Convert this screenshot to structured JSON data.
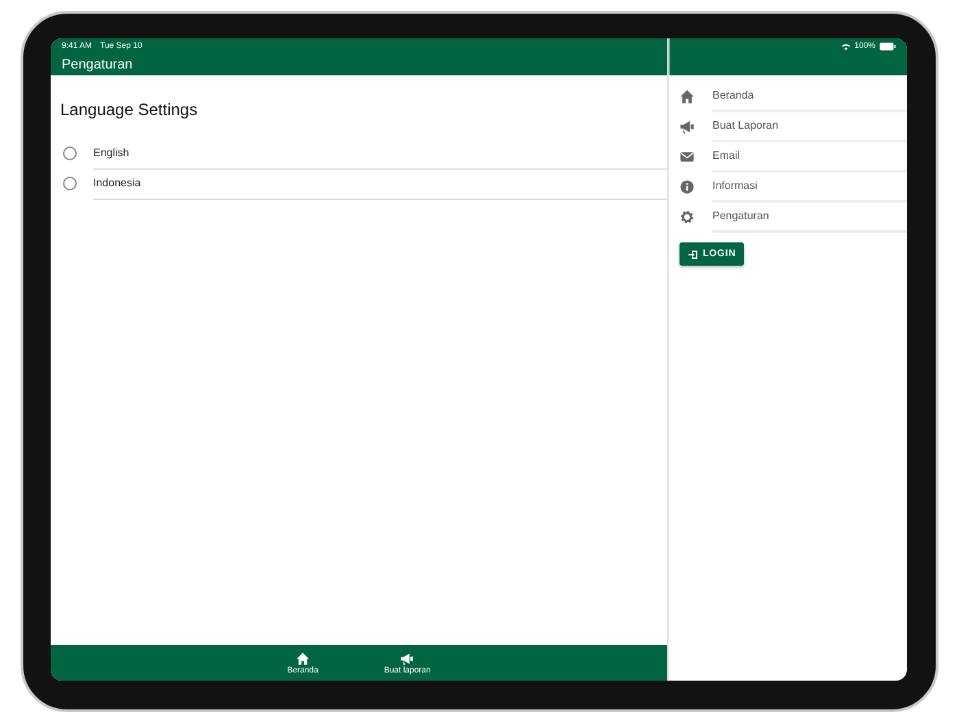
{
  "status_bar": {
    "time": "9:41 AM",
    "date": "Tue Sep 10",
    "battery": "100%"
  },
  "header": {
    "title": "Pengaturan"
  },
  "page": {
    "heading": "Language Settings",
    "options": [
      {
        "label": "English",
        "selected": false
      },
      {
        "label": "Indonesia",
        "selected": false
      }
    ]
  },
  "bottom_tabs": [
    {
      "label": "Beranda",
      "kind": "home"
    },
    {
      "label": "Buat laporan",
      "kind": "megaphone"
    }
  ],
  "sidebar": {
    "items": [
      {
        "label": "Beranda",
        "kind": "home"
      },
      {
        "label": "Buat Laporan",
        "kind": "megaphone"
      },
      {
        "label": "Email",
        "kind": "mail"
      },
      {
        "label": "Informasi",
        "kind": "info"
      },
      {
        "label": "Pengaturan",
        "kind": "gear"
      }
    ],
    "login_button": "LOGIN"
  }
}
